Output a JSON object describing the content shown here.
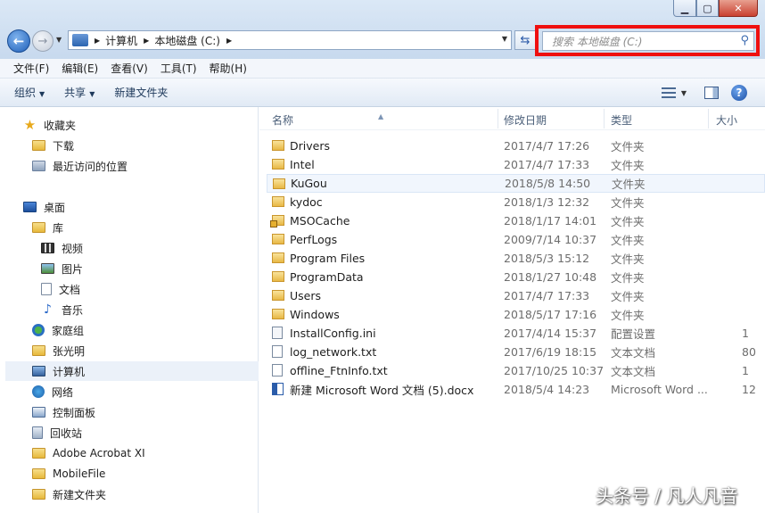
{
  "window": {
    "min": "▁",
    "max": "▢",
    "close": "✕"
  },
  "address": {
    "crumbs": [
      "计算机",
      "本地磁盘 (C:)"
    ]
  },
  "search": {
    "placeholder": "搜索 本地磁盘 (C:)"
  },
  "menu": [
    "文件(F)",
    "编辑(E)",
    "查看(V)",
    "工具(T)",
    "帮助(H)"
  ],
  "toolbar": {
    "organize": "组织",
    "share": "共享",
    "new_folder": "新建文件夹",
    "help": "?"
  },
  "nav": {
    "favorites": "收藏夹",
    "downloads": "下载",
    "recent": "最近访问的位置",
    "desktop": "桌面",
    "libraries": "库",
    "videos": "视频",
    "pictures": "图片",
    "documents": "文档",
    "music": "音乐",
    "homegroup": "家庭组",
    "user": "张光明",
    "computer": "计算机",
    "network": "网络",
    "control_panel": "控制面板",
    "recycle_bin": "回收站",
    "acrobat": "Adobe Acrobat XI",
    "mobilefile": "MobileFile",
    "newfolder": "新建文件夹"
  },
  "columns": {
    "name": "名称",
    "date": "修改日期",
    "type": "类型",
    "size": "大小"
  },
  "files": [
    {
      "name": "Drivers",
      "date": "2017/4/7 17:26",
      "type": "文件夹",
      "size": "",
      "icon": "folder"
    },
    {
      "name": "Intel",
      "date": "2017/4/7 17:33",
      "type": "文件夹",
      "size": "",
      "icon": "folder"
    },
    {
      "name": "KuGou",
      "date": "2018/5/8 14:50",
      "type": "文件夹",
      "size": "",
      "icon": "folder"
    },
    {
      "name": "kydoc",
      "date": "2018/1/3 12:32",
      "type": "文件夹",
      "size": "",
      "icon": "folder"
    },
    {
      "name": "MSOCache",
      "date": "2018/1/17 14:01",
      "type": "文件夹",
      "size": "",
      "icon": "locked"
    },
    {
      "name": "PerfLogs",
      "date": "2009/7/14 10:37",
      "type": "文件夹",
      "size": "",
      "icon": "folder"
    },
    {
      "name": "Program Files",
      "date": "2018/5/3 15:12",
      "type": "文件夹",
      "size": "",
      "icon": "folder"
    },
    {
      "name": "ProgramData",
      "date": "2018/1/27 10:48",
      "type": "文件夹",
      "size": "",
      "icon": "folder"
    },
    {
      "name": "Users",
      "date": "2017/4/7 17:33",
      "type": "文件夹",
      "size": "",
      "icon": "folder"
    },
    {
      "name": "Windows",
      "date": "2018/5/17 17:16",
      "type": "文件夹",
      "size": "",
      "icon": "folder"
    },
    {
      "name": "InstallConfig.ini",
      "date": "2017/4/14 15:37",
      "type": "配置设置",
      "size": "1",
      "icon": "ini"
    },
    {
      "name": "log_network.txt",
      "date": "2017/6/19 18:15",
      "type": "文本文档",
      "size": "80",
      "icon": "txt"
    },
    {
      "name": "offline_FtnInfo.txt",
      "date": "2017/10/25 10:37",
      "type": "文本文档",
      "size": "1",
      "icon": "txt"
    },
    {
      "name": "新建 Microsoft Word 文档 (5).docx",
      "date": "2018/5/4 14:23",
      "type": "Microsoft Word ...",
      "size": "12",
      "icon": "word"
    }
  ],
  "watermark": "头条号 / 凡人凡音",
  "colors": {
    "highlight": "#ef1010",
    "selection": "#ebf1f9"
  }
}
